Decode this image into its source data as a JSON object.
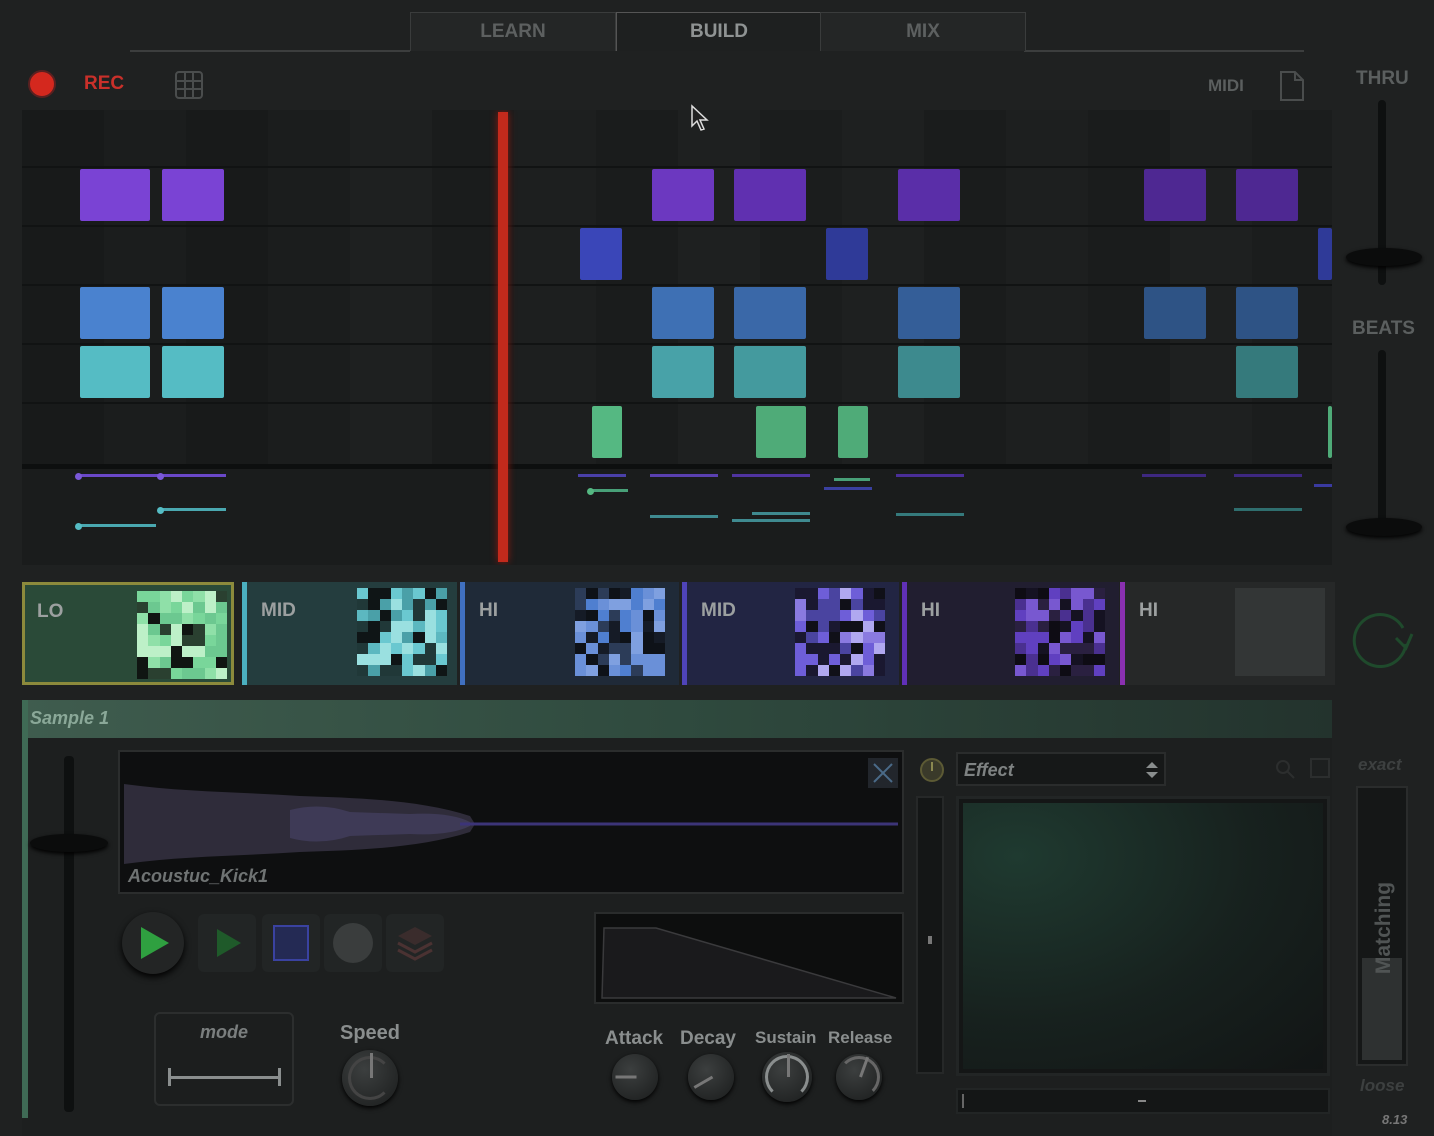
{
  "tabs": {
    "learn": "LEARN",
    "build": "BUILD",
    "mix": "MIX"
  },
  "toolbar": {
    "rec_label": "REC",
    "midi_label": "MIDI"
  },
  "side": {
    "thru_label": "THRU",
    "beats_label": "BEATS",
    "exact_label": "exact",
    "matching_label": "Matching",
    "loose_label": "loose",
    "version": "8.13"
  },
  "pads": [
    {
      "label": "LO",
      "color": "#8fe0a8"
    },
    {
      "label": "MID",
      "color": "#6ac8d0"
    },
    {
      "label": "HI",
      "color": "#4f7fd0"
    },
    {
      "label": "MID",
      "color": "#6e5ed8"
    },
    {
      "label": "HI",
      "color": "#6040c0"
    },
    {
      "label": "HI",
      "color": "#a040c8"
    }
  ],
  "sample": {
    "title": "Sample 1",
    "file_name": "Acoustuc_Kick1",
    "effect_label": "Effect",
    "mode_label": "mode",
    "speed_label": "Speed",
    "attack_label": "Attack",
    "decay_label": "Decay",
    "sustain_label": "Sustain",
    "release_label": "Release"
  },
  "colors": {
    "accent_red": "#d4281e",
    "row1": "#7a43d4",
    "row2": "#3a46b8",
    "row3": "#4a82cf",
    "row4": "#55bcc4",
    "row5": "#55b882"
  }
}
